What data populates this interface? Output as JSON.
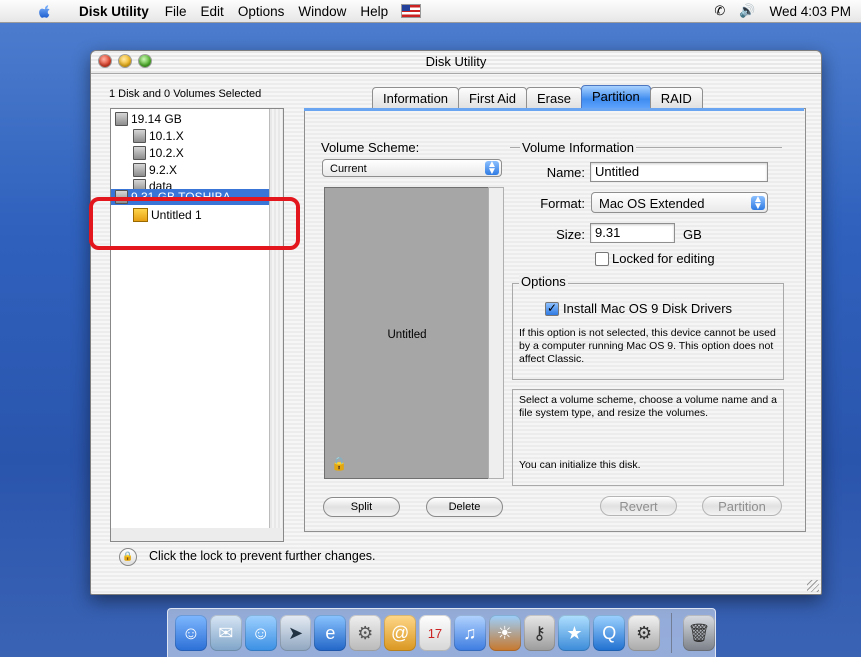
{
  "menubar": {
    "app": "Disk Utility",
    "items": [
      "File",
      "Edit",
      "Options",
      "Window",
      "Help"
    ],
    "clock": "Wed 4:03 PM"
  },
  "window": {
    "title": "Disk Utility",
    "selection_label": "1 Disk and 0 Volumes Selected",
    "disks": [
      {
        "label": "19.14 GB",
        "type": "disk"
      },
      {
        "label": "10.1.X",
        "type": "partition"
      },
      {
        "label": "10.2.X",
        "type": "partition"
      },
      {
        "label": "9.2.X",
        "type": "partition"
      },
      {
        "label": "data",
        "type": "partition"
      },
      {
        "label": "9.31 GB TOSHIBA",
        "type": "disk",
        "selected": true
      },
      {
        "label": "Untitled 1",
        "type": "volume"
      }
    ],
    "tabs": [
      "Information",
      "First Aid",
      "Erase",
      "Partition",
      "RAID"
    ],
    "active_tab": "Partition",
    "partition": {
      "volume_scheme_label": "Volume Scheme:",
      "volume_scheme_value": "Current",
      "map_volume_name": "Untitled",
      "volume_info_label": "Volume Information",
      "name_label": "Name:",
      "name_value": "Untitled",
      "format_label": "Format:",
      "format_value": "Mac OS Extended",
      "size_label": "Size:",
      "size_value": "9.31",
      "size_unit": "GB",
      "locked_label": "Locked for editing",
      "options_label": "Options",
      "install_drivers_label": "Install Mac OS 9 Disk Drivers",
      "install_drivers_help": "If this option is not selected, this device cannot be used by a computer running Mac OS 9.  This option does not affect Classic.",
      "instructions": "Select a volume scheme, choose a volume name and a file system type, and resize the volumes.",
      "init_note": "You can initialize this disk.",
      "split_button": "Split",
      "delete_button": "Delete",
      "revert_button": "Revert",
      "partition_button": "Partition"
    },
    "lock_message": "Click the lock to prevent further changes."
  },
  "dock": {
    "icons": [
      "finder-icon",
      "mail-icon",
      "ichat-icon",
      "safari-icon",
      "ie-icon",
      "preview-icon",
      "address-book-icon",
      "ical-icon",
      "itunes-icon",
      "iphoto-icon",
      "sherlock-icon",
      "imovie-icon",
      "quicktime-icon",
      "system-preferences-icon",
      "trash-icon"
    ]
  }
}
